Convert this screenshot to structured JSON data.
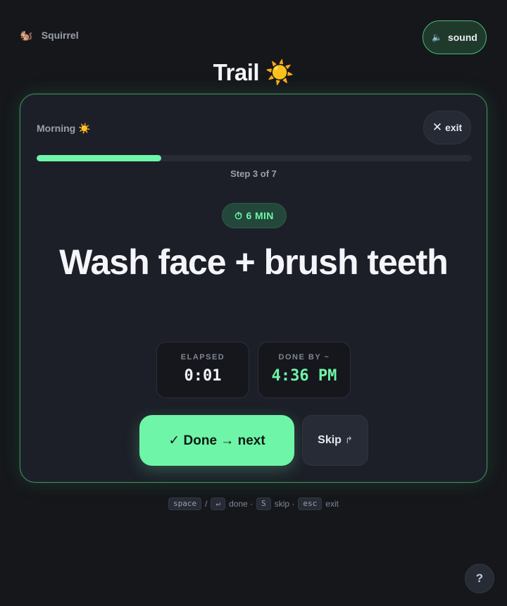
{
  "app": {
    "name": "Squirrel",
    "logo_emoji": "🐿️"
  },
  "header": {
    "sound_label": "sound",
    "sound_icon": "🔈",
    "sound_icon_name": "speaker-icon"
  },
  "page": {
    "title": "Trail ☀️"
  },
  "card": {
    "routine_label": "Morning ☀️",
    "exit_label": "exit",
    "exit_icon": "✕",
    "progress": {
      "current": 3,
      "total": 7,
      "fraction": 0.2857,
      "label": "Step 3 of 7"
    },
    "duration_badge": {
      "icon": "⏱",
      "text": "6 MIN"
    },
    "step_title": "Wash face + brush teeth",
    "stats": {
      "elapsed": {
        "label": "ELAPSED",
        "value": "0:01"
      },
      "done_by": {
        "label": "DONE BY ~",
        "value": "4:36 PM"
      }
    },
    "done_button": "✓ Done → next",
    "skip_button": {
      "label": "Skip",
      "icon": "↱"
    }
  },
  "hints": {
    "keys": {
      "space": "space",
      "enter": "↵",
      "skip": "S",
      "esc": "esc"
    },
    "separator": "/",
    "done_text": "done ·",
    "skip_text": "skip ·",
    "exit_text": "exit"
  },
  "help": {
    "label": "?"
  },
  "colors": {
    "accent": "#6ff5a8",
    "background": "#15171b",
    "card": "#1c1f28"
  }
}
